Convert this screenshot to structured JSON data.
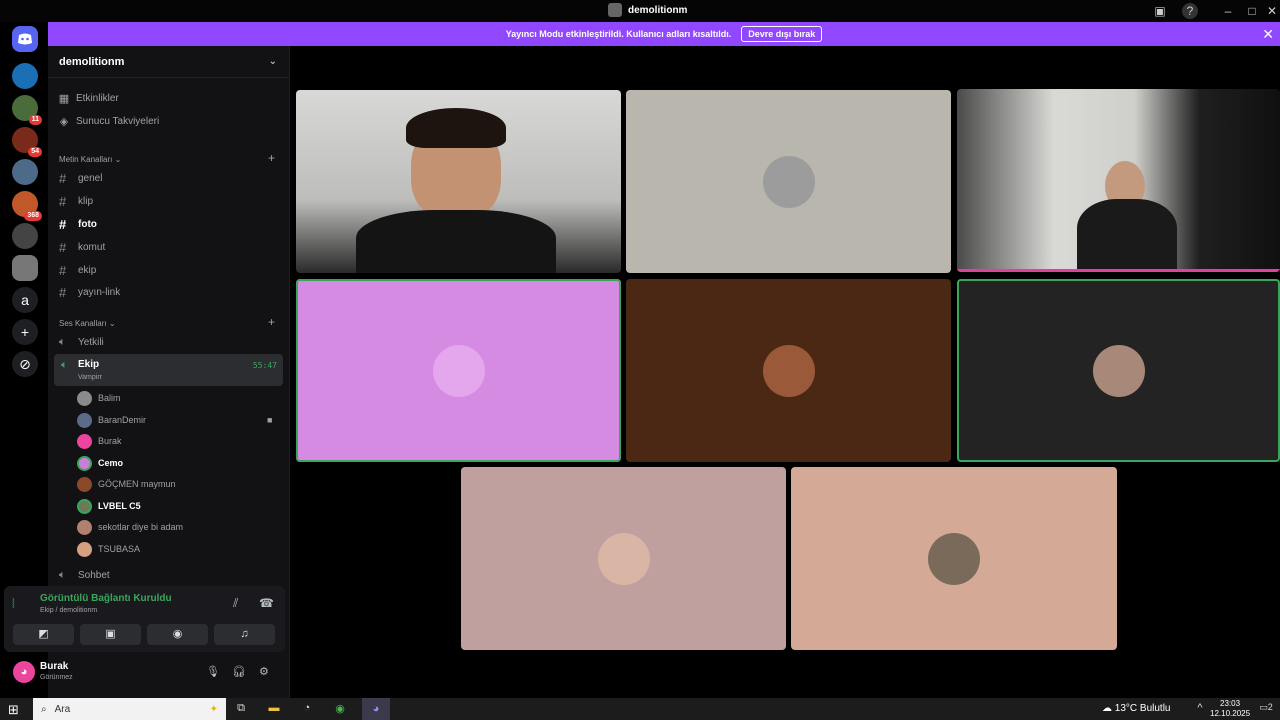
{
  "window": {
    "title": "demolitionm"
  },
  "banner": {
    "message": "Yayıncı Modu etkinleştirildi. Kullanıcı adları kısaltıldı.",
    "disable_label": "Devre dışı bırak"
  },
  "server_badges": [
    "11",
    "54",
    "368"
  ],
  "rail_letter": "a",
  "guild": {
    "name": "demolitionm"
  },
  "guild_menu": {
    "events": "Etkinlikler",
    "boosts": "Sunucu Takviyeleri"
  },
  "text_category": "Metin Kanalları",
  "text_channels": [
    "genel",
    "klip",
    "foto",
    "komut",
    "ekip",
    "yayın-link"
  ],
  "voice_category": "Ses Kanalları",
  "voice_channels": {
    "first": "Yetkili",
    "active": "Ekip",
    "active_sub": "Vampirr",
    "active_timer": "55:47",
    "last": "Sohbet"
  },
  "members": [
    "Balim",
    "BaranDemir",
    "Burak",
    "Cemo",
    "GÖÇMEN maymun",
    "LVBEL C5",
    "sekotlar diye bi adam",
    "TSUBASA"
  ],
  "connection": {
    "status": "Görüntülü Bağlantı Kuruldu",
    "location": "Ekip / demolitionm"
  },
  "user": {
    "name": "Burak",
    "status": "Görünmez"
  },
  "taskbar": {
    "search_placeholder": "Ara",
    "weather": "13°C  Bulutlu",
    "time": "23:03",
    "date": "12.10.2025",
    "notif_count": "2"
  },
  "colors": {
    "accent": "#9147ff",
    "online": "#3ba55c",
    "banner_text": "#ffffff"
  }
}
